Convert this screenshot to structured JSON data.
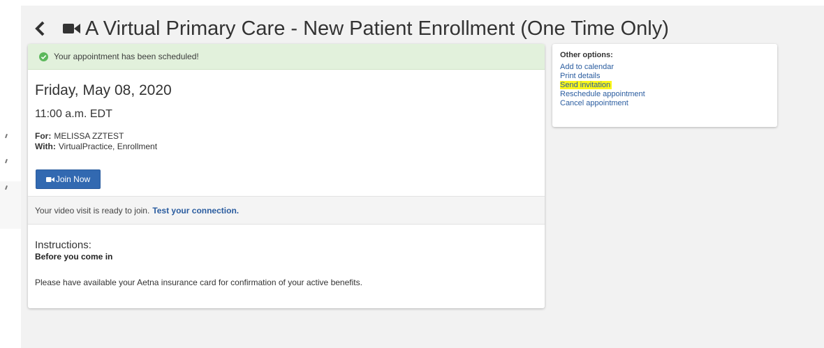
{
  "header": {
    "title": "A Virtual Primary Care - New Patient Enrollment (One Time Only)"
  },
  "alert": {
    "message": "Your appointment has been scheduled!"
  },
  "appointment": {
    "date": "Friday, May 08, 2020",
    "time": "11:00 a.m. EDT",
    "for_label": "For:",
    "for_value": "MELISSA ZZTEST",
    "with_label": "With:",
    "with_value": "VirtualPractice, Enrollment",
    "join_label": "Join Now"
  },
  "video": {
    "ready_text": "Your video visit is ready to join.",
    "test_link": "Test your connection."
  },
  "instructions": {
    "heading": "Instructions:",
    "subheading": "Before you come in",
    "body": "Please have available your Aetna insurance card for confirmation of your active benefits."
  },
  "options": {
    "title": "Other options:",
    "items": [
      {
        "label": "Add to calendar"
      },
      {
        "label": "Print details"
      },
      {
        "label": "Send invitation"
      },
      {
        "label": "Reschedule appointment"
      },
      {
        "label": "Cancel appointment"
      }
    ]
  },
  "colors": {
    "link": "#2a5c9f",
    "button": "#3269b1",
    "alert_bg": "#e2f1dc",
    "success": "#5cb85c",
    "highlight": "#fbf71a"
  },
  "icons": {
    "back": "chevron-left-icon",
    "title": "video-camera-icon",
    "alert": "check-circle-icon",
    "join": "video-camera-icon"
  }
}
